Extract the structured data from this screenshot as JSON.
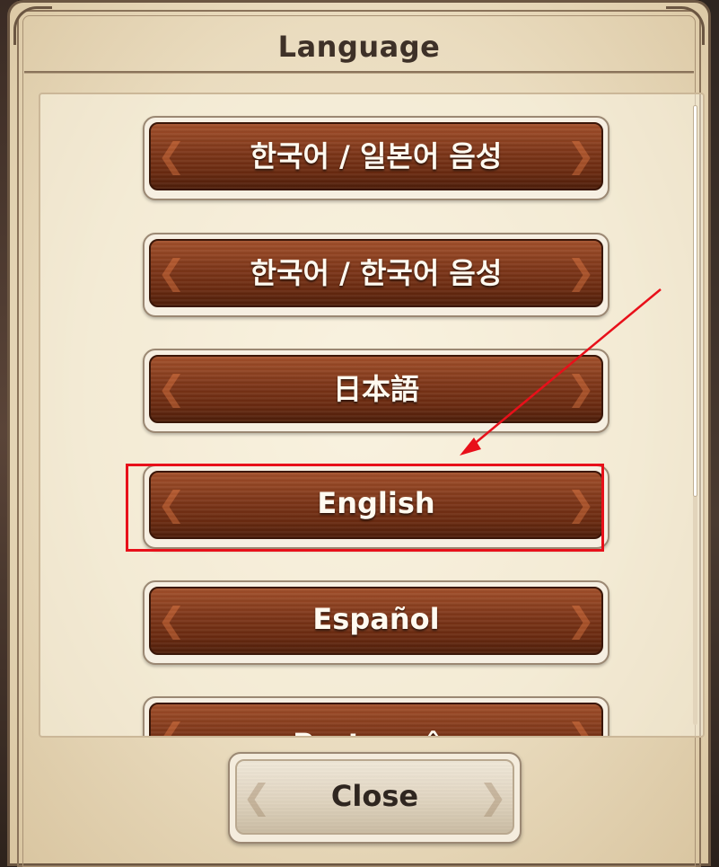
{
  "dialog": {
    "title": "Language",
    "close_label": "Close"
  },
  "languages": [
    {
      "label": "한국어 / 일본어 음성"
    },
    {
      "label": "한국어 / 한국어 음성"
    },
    {
      "label": "日本語"
    },
    {
      "label": "English",
      "highlighted": true
    },
    {
      "label": "Español"
    },
    {
      "label": "Português"
    }
  ],
  "icons": {
    "button_ornament_left": "ornament-left-icon",
    "button_ornament_right": "ornament-right-icon"
  },
  "colors": {
    "button_brown": "#7c3518",
    "parchment": "#eadcbf",
    "highlight_red": "#e8101a"
  }
}
